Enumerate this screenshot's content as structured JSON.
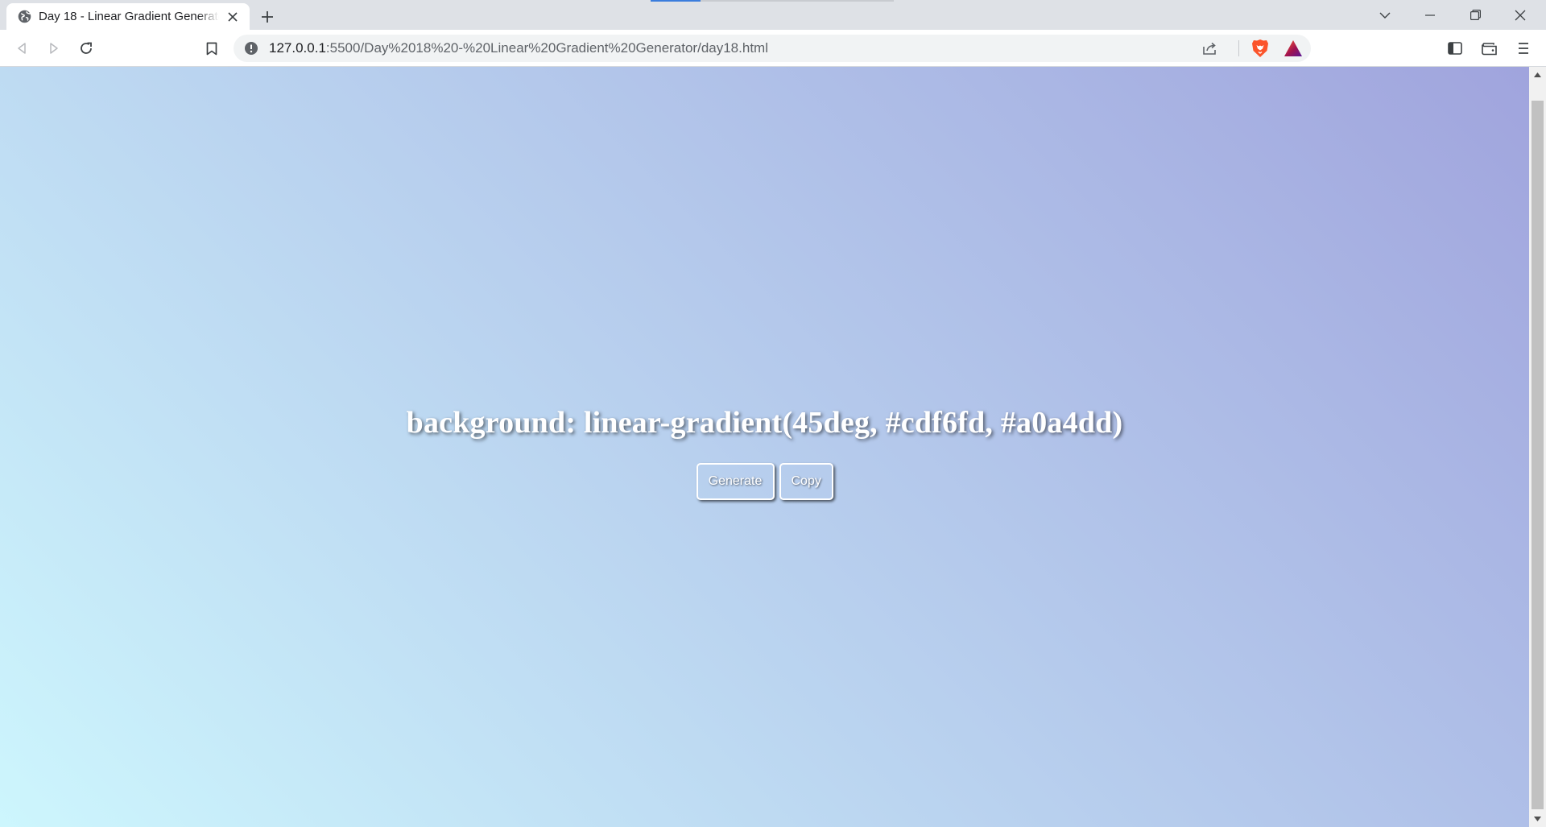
{
  "browser": {
    "tab": {
      "title": "Day 18 - Linear Gradient Generator"
    },
    "address_bar": {
      "url_host": "127.0.0.1",
      "url_rest": ":5500/Day%2018%20-%20Linear%20Gradient%20Generator/day18.html"
    },
    "icons": {
      "tab_favicon": "globe-icon",
      "tab_close": "close-icon",
      "new_tab": "plus-icon",
      "tab_search": "chevron-down-icon",
      "minimize": "minimize-icon",
      "restore": "restore-icon",
      "close_window": "close-icon",
      "back": "back-icon",
      "forward": "forward-icon",
      "reload": "reload-icon",
      "bookmark": "bookmark-icon",
      "site_info": "info-icon",
      "share": "share-icon",
      "brave_shields": "brave-lion-icon",
      "brave_rewards": "rewards-triangle-icon",
      "sidebar": "sidebar-icon",
      "wallet": "wallet-icon",
      "menu": "menu-icon"
    }
  },
  "page": {
    "gradient_text": "background: linear-gradient(45deg, #cdf6fd, #a0a4dd)",
    "buttons": {
      "generate": "Generate",
      "copy": "Copy"
    },
    "colors": {
      "gradient_start": "#cdf6fd",
      "gradient_end": "#a0a4dd",
      "gradient_angle": "45deg"
    }
  }
}
